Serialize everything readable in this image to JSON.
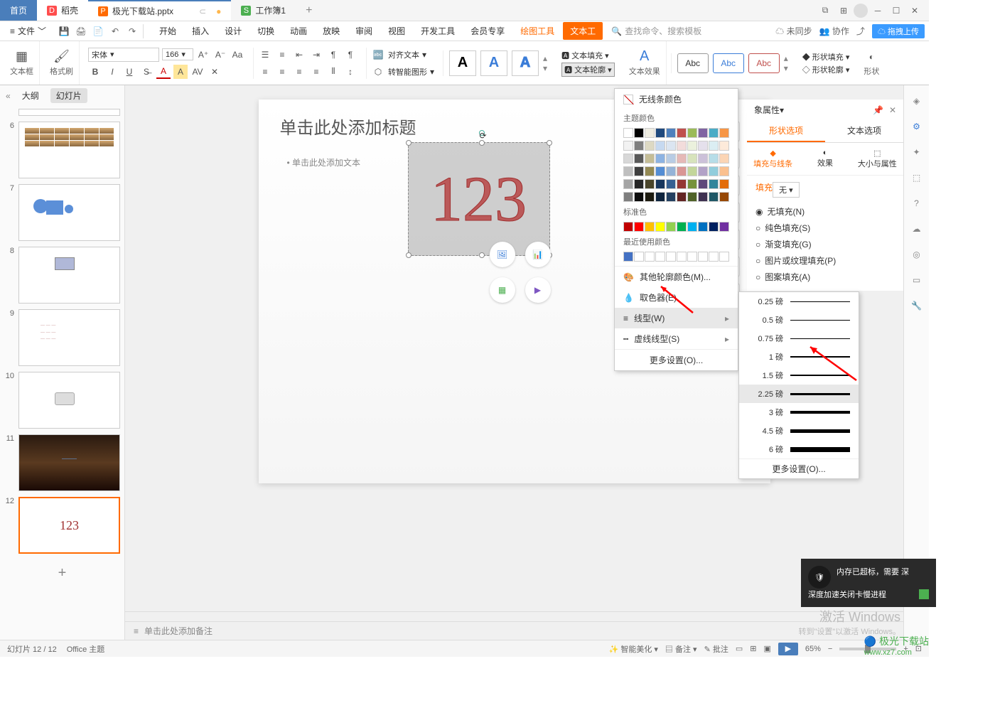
{
  "app_tabs": {
    "home": "首页",
    "docker": "稻壳",
    "file": "极光下载站.pptx",
    "workbook": "工作簿1"
  },
  "menu": {
    "file": "文件",
    "tabs": [
      "开始",
      "插入",
      "设计",
      "切换",
      "动画",
      "放映",
      "审阅",
      "视图",
      "开发工具",
      "会员专享"
    ],
    "draw_tool": "绘图工具",
    "text_tool": "文本工",
    "search_placeholder": "查找命令、搜索模板",
    "unsync": "未同步",
    "collab": "协作",
    "upload": "拖拽上传"
  },
  "ribbon": {
    "textbox": "文本框",
    "format_painter": "格式刷",
    "font": "宋体",
    "size": "166",
    "align_text": "对齐文本",
    "convert_smart": "转智能图形",
    "text_fill": "文本填充",
    "text_outline": "文本轮廓",
    "text_effect": "文本效果",
    "shape_fill": "形状填充",
    "shape_outline": "形状轮廓",
    "shape": "形状",
    "abc": "Abc"
  },
  "thumb_panel": {
    "outline": "大纲",
    "slides": "幻灯片",
    "collapse": "«"
  },
  "slide": {
    "title_placeholder": "单击此处添加标题",
    "bullet_placeholder": "单击此处添加文本",
    "text_content": "123"
  },
  "notes": {
    "placeholder": "单击此处添加备注"
  },
  "dropdown": {
    "no_line": "无线条颜色",
    "theme_colors": "主题颜色",
    "standard_colors": "标准色",
    "recent_colors": "最近使用颜色",
    "more_colors": "其他轮廓颜色(M)...",
    "eyedropper": "取色器(E)",
    "line_type": "线型(W)",
    "dash_type": "虚线线型(S)",
    "more_settings": "更多设置(O)..."
  },
  "line_weights": {
    "items": [
      "0.25 磅",
      "0.5 磅",
      "0.75 磅",
      "1 磅",
      "1.5 磅",
      "2.25 磅",
      "3 磅",
      "4.5 磅",
      "6 磅"
    ],
    "more": "更多设置(O)..."
  },
  "props": {
    "header": "象属性",
    "shape_options": "形状选项",
    "text_options": "文本选项",
    "fill_line": "填充与线条",
    "effect": "效果",
    "size_props": "大小与属性",
    "fill_section": "填充",
    "fill_none_combo": "无",
    "no_fill": "无填充(N)",
    "solid_fill": "纯色填充(S)",
    "gradient_fill": "渐变填充(G)",
    "picture_fill": "图片或纹理填充(P)",
    "pattern_fill": "图案填充(A)"
  },
  "status": {
    "slide_count": "幻灯片 12 / 12",
    "theme": "Office 主题",
    "smart_beautify": "智能美化",
    "notes_btn": "备注",
    "comments_btn": "批注",
    "zoom": "65%"
  },
  "watermark": {
    "activate": "激活 Windows",
    "goto": "转到\"设置\"以激活 Windows。",
    "site": "极光下载站",
    "url": "www.xz7.com"
  },
  "notif": {
    "line1": "内存已超标，需要 深",
    "line2": "深度加速关闭卡慢进程"
  },
  "theme_palette_row1": [
    "#ffffff",
    "#000000",
    "#eeece1",
    "#1f497d",
    "#4f81bd",
    "#c0504d",
    "#9bbb59",
    "#8064a2",
    "#4bacc6",
    "#f79646"
  ],
  "standard_palette": [
    "#c00000",
    "#ff0000",
    "#ffc000",
    "#ffff00",
    "#92d050",
    "#00b050",
    "#00b0f0",
    "#0070c0",
    "#002060",
    "#7030a0"
  ]
}
